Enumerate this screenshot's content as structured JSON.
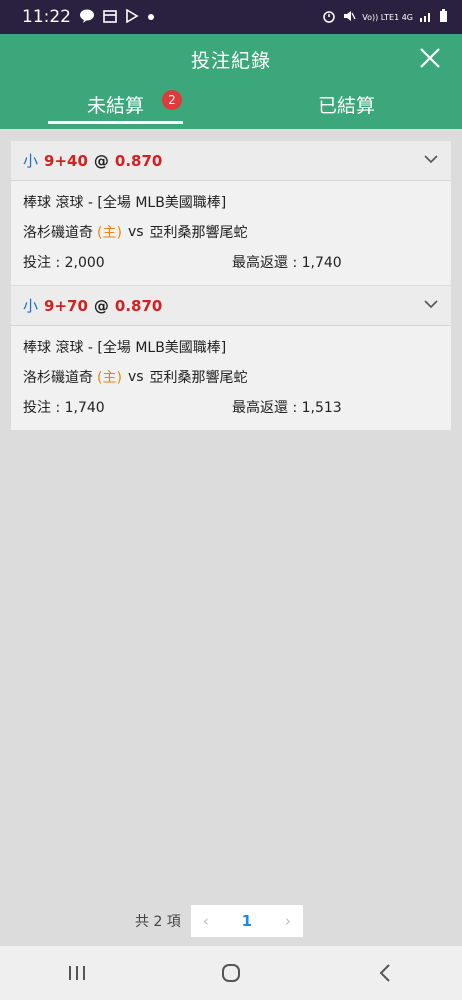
{
  "status_bar": {
    "time": "11:22",
    "left_icons": [
      "line-icon",
      "calendar-icon",
      "play-store-icon",
      "dot-icon"
    ],
    "right_text": "Vo)) LTE1 4G",
    "right_icons": [
      "alarm-icon",
      "mute-icon",
      "signal-icon",
      "battery-icon"
    ]
  },
  "header": {
    "title": "投注紀錄"
  },
  "tabs": [
    {
      "label": "未結算",
      "badge": "2",
      "active": true
    },
    {
      "label": "已結算",
      "active": false
    }
  ],
  "bets": [
    {
      "direction": "小",
      "line": "9+40",
      "at": "@",
      "odds": "0.870",
      "market": "棒球 滾球 - [全場 MLB美國職棒]",
      "home": "洛杉磯道奇",
      "home_tag": "(主)",
      "vs": "vs",
      "away": "亞利桑那響尾蛇",
      "stake": "投注 : 2,000",
      "max_return": "最高返還 : 1,740"
    },
    {
      "direction": "小",
      "line": "9+70",
      "at": "@",
      "odds": "0.870",
      "market": "棒球 滾球 - [全場 MLB美國職棒]",
      "home": "洛杉磯道奇",
      "home_tag": "(主)",
      "vs": "vs",
      "away": "亞利桑那響尾蛇",
      "stake": "投注 : 1,740",
      "max_return": "最高返還 : 1,513"
    }
  ],
  "pagination": {
    "total": "共 2 項",
    "prev": "‹",
    "current": "1",
    "next": "›"
  },
  "colors": {
    "accent": "#3ca77a",
    "badge": "#e03b3b",
    "odds": "#d42020",
    "direction": "#1e6fc8",
    "home_tag": "#e8841c"
  }
}
